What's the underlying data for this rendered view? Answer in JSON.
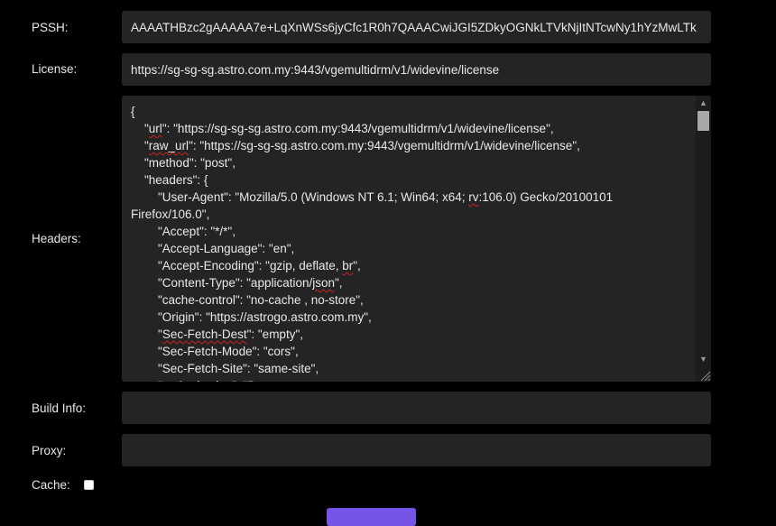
{
  "labels": {
    "pssh": "PSSH:",
    "license": "License:",
    "headers": "Headers:",
    "build_info": "Build Info:",
    "proxy": "Proxy:",
    "cache": "Cache:"
  },
  "fields": {
    "pssh_value": "AAAATHBzc2gAAAAA7e+LqXnWSs6jyCfc1R0h7QAAACwiJGI5ZDkyOGNkLTVkNjItNTcwNy1hYzMwLTk",
    "license_value": "https://sg-sg-sg.astro.com.my:9443/vgemultidrm/v1/widevine/license",
    "build_info_value": "",
    "proxy_value": ""
  },
  "headers_text": {
    "lines": [
      "{",
      "    \"url\": \"https://sg-sg-sg.astro.com.my:9443/vgemultidrm/v1/widevine/license\",",
      "    \"raw_url\": \"https://sg-sg-sg.astro.com.my:9443/vgemultidrm/v1/widevine/license\",",
      "    \"method\": \"post\",",
      "    \"headers\": {",
      "        \"User-Agent\": \"Mozilla/5.0 (Windows NT 6.1; Win64; x64; rv:106.0) Gecko/20100101",
      "Firefox/106.0\",",
      "        \"Accept\": \"*/*\",",
      "        \"Accept-Language\": \"en\",",
      "        \"Accept-Encoding\": \"gzip, deflate, br\",",
      "        \"Content-Type\": \"application/json\",",
      "        \"cache-control\": \"no-cache , no-store\",",
      "        \"Origin\": \"https://astrogo.astro.com.my\",",
      "        \"Sec-Fetch-Dest\": \"empty\",",
      "        \"Sec-Fetch-Mode\": \"cors\",",
      "        \"Sec-Fetch-Site\": \"same-site\",",
      "        \"authorization\": \"B"
    ]
  },
  "cache_checked": false,
  "colors": {
    "background": "#000000",
    "field": "#242424",
    "accent": "#7754e8"
  }
}
